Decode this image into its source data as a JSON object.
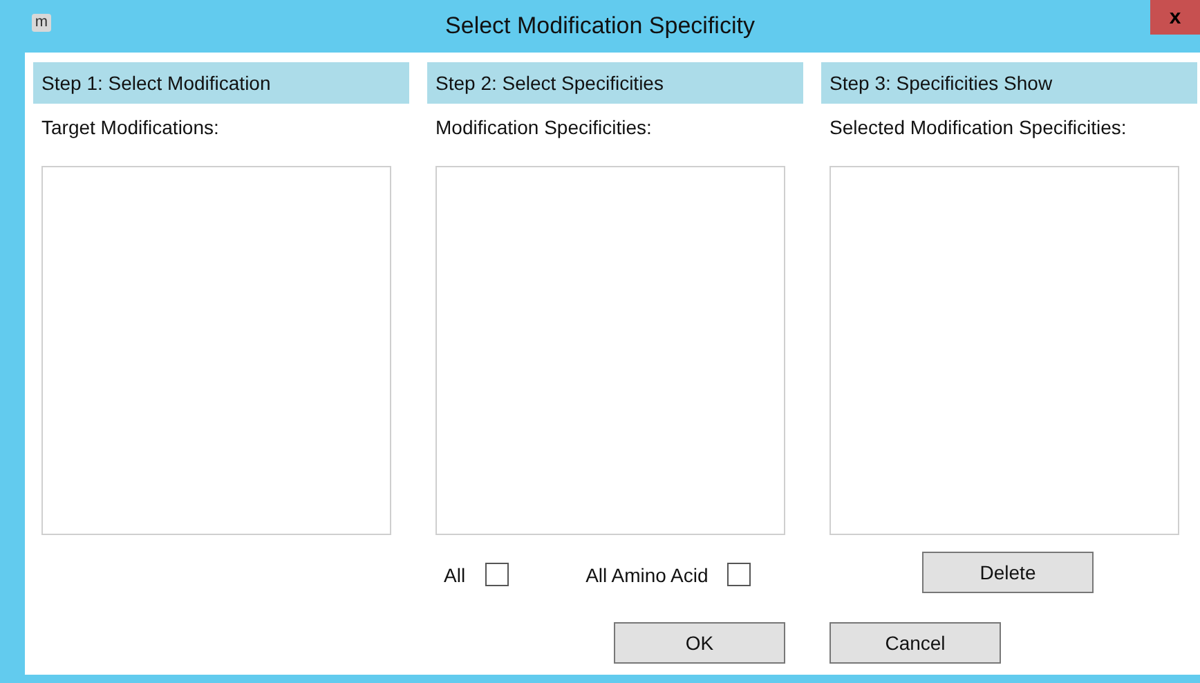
{
  "window": {
    "title": "Select Modification Specificity",
    "icon": "m",
    "close": "x"
  },
  "steps": [
    {
      "header": "Step 1: Select Modification",
      "label": "Target Modifications:"
    },
    {
      "header": "Step 2: Select Specificities",
      "label": "Modification Specificities:",
      "checkboxes": [
        {
          "label": "All",
          "checked": false
        },
        {
          "label": "All Amino Acid",
          "checked": false
        }
      ]
    },
    {
      "header": "Step 3: Specificities Show",
      "label": "Selected Modification Specificities:",
      "button": "Delete"
    }
  ],
  "buttons": [
    "OK",
    "Cancel"
  ]
}
